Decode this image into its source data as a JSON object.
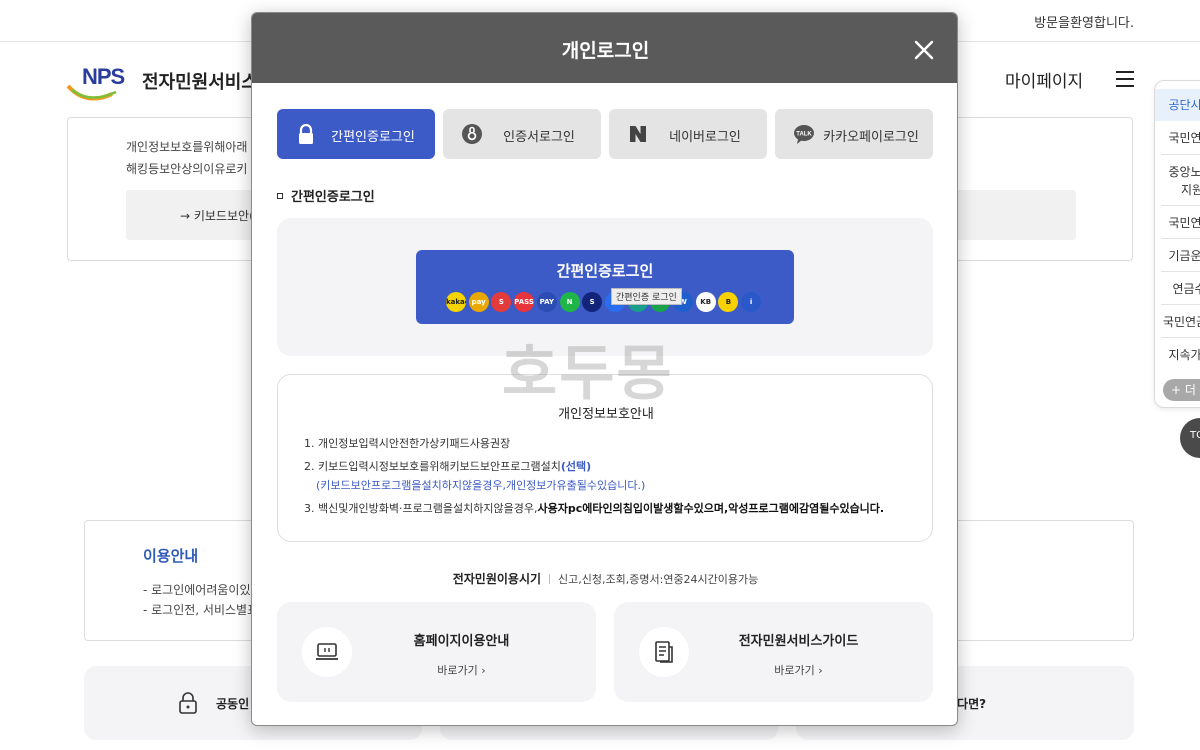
{
  "topbar": {
    "welcome": "방문을환영합니다."
  },
  "header": {
    "logo_letters": "NPS",
    "site_name": "전자민원서비스",
    "mypage": "마이페이지"
  },
  "background_notice": {
    "line1": "개인정보보호를위해아래",
    "line2": "해킹등보안상의이유로키",
    "keyboard_security": "→ 키보드보안("
  },
  "usage": {
    "title": "이용안내",
    "item1": "- 로그인에어려움이있으",
    "item2": "- 로그인전, 서비스별표"
  },
  "bottom_cards": {
    "c1_text": "공동인",
    "c3_text": "났다면?"
  },
  "quick_panel": {
    "items": [
      "공단시",
      "국민연",
      "중앙노",
      "지원",
      "국민연",
      "기금운",
      "연금수",
      "국민연금",
      "지속가"
    ],
    "more": "+ 더",
    "top": "TOP"
  },
  "modal": {
    "title": "개인로그인",
    "tabs": [
      {
        "label": "간편인증로그인",
        "icon": "lock-icon",
        "active": true
      },
      {
        "label": "인증서로그인",
        "icon": "certificate-icon",
        "active": false
      },
      {
        "label": "네이버로그인",
        "icon": "naver-icon",
        "active": false
      },
      {
        "label": "카카오페이로그인",
        "icon": "kakao-talk-icon",
        "active": false
      }
    ],
    "section_title": "간편인증로그인",
    "simple_button": {
      "label": "간편인증로그인",
      "tooltip": "간편인증 로그인",
      "provider_icons": [
        {
          "name": "kakao",
          "text": "kakao",
          "color": "#f5d400"
        },
        {
          "name": "payco",
          "text": "pay",
          "color": "#e8a800"
        },
        {
          "name": "samsung-pass",
          "text": "S",
          "color": "#e33b3b"
        },
        {
          "name": "pass",
          "text": "PASS",
          "color": "#e8343c"
        },
        {
          "name": "payco2",
          "text": "PAY",
          "color": "#2c4db3"
        },
        {
          "name": "naver",
          "text": "N",
          "color": "#1fb548"
        },
        {
          "name": "shinhan",
          "text": "S",
          "color": "#12257a"
        },
        {
          "name": "toss",
          "text": "t",
          "color": "#2a6ef0"
        },
        {
          "name": "hana",
          "text": "H",
          "color": "#1a9e8c"
        },
        {
          "name": "nh",
          "text": "NH",
          "color": "#1aa34a"
        },
        {
          "name": "woori",
          "text": "W",
          "color": "#1f5fcc"
        },
        {
          "name": "kb",
          "text": "KB",
          "color": "#ffffff"
        },
        {
          "name": "kbank",
          "text": "B",
          "color": "#f7d100"
        },
        {
          "name": "ibk",
          "text": "i",
          "color": "#2a58c9"
        }
      ]
    },
    "watermark": "호두몽",
    "privacy": {
      "title": "개인정보보호안내",
      "item1": "1.  개인정보입력시안전한가상키패드사용권장",
      "item2_prefix": "2.  키보드입력시정보보호를위해키보드보안프로그램설치",
      "item2_highlight": "(선택)",
      "item2_sub": "(키보드보안프로그램을설치하지않을경우,개인정보가유출될수있습니다.)",
      "item3_prefix": "3.  백신및개인방화벽·프로그램을설치하지않을경우,",
      "item3_bold": "사용자pc에타인의침입이발생할수있으며,악성프로그램에감염될수있습니다."
    },
    "service_time": {
      "label": "전자민원이용시기",
      "desc": "신고,신청,조회,증명서:연중24시간이용가능"
    },
    "guide_cards": [
      {
        "title": "홈페이지이용안내",
        "link": "바로가기  ›",
        "icon": "laptop-icon"
      },
      {
        "title": "전자민원서비스가이드",
        "link": "바로가기  ›",
        "icon": "document-guide-icon"
      }
    ]
  }
}
